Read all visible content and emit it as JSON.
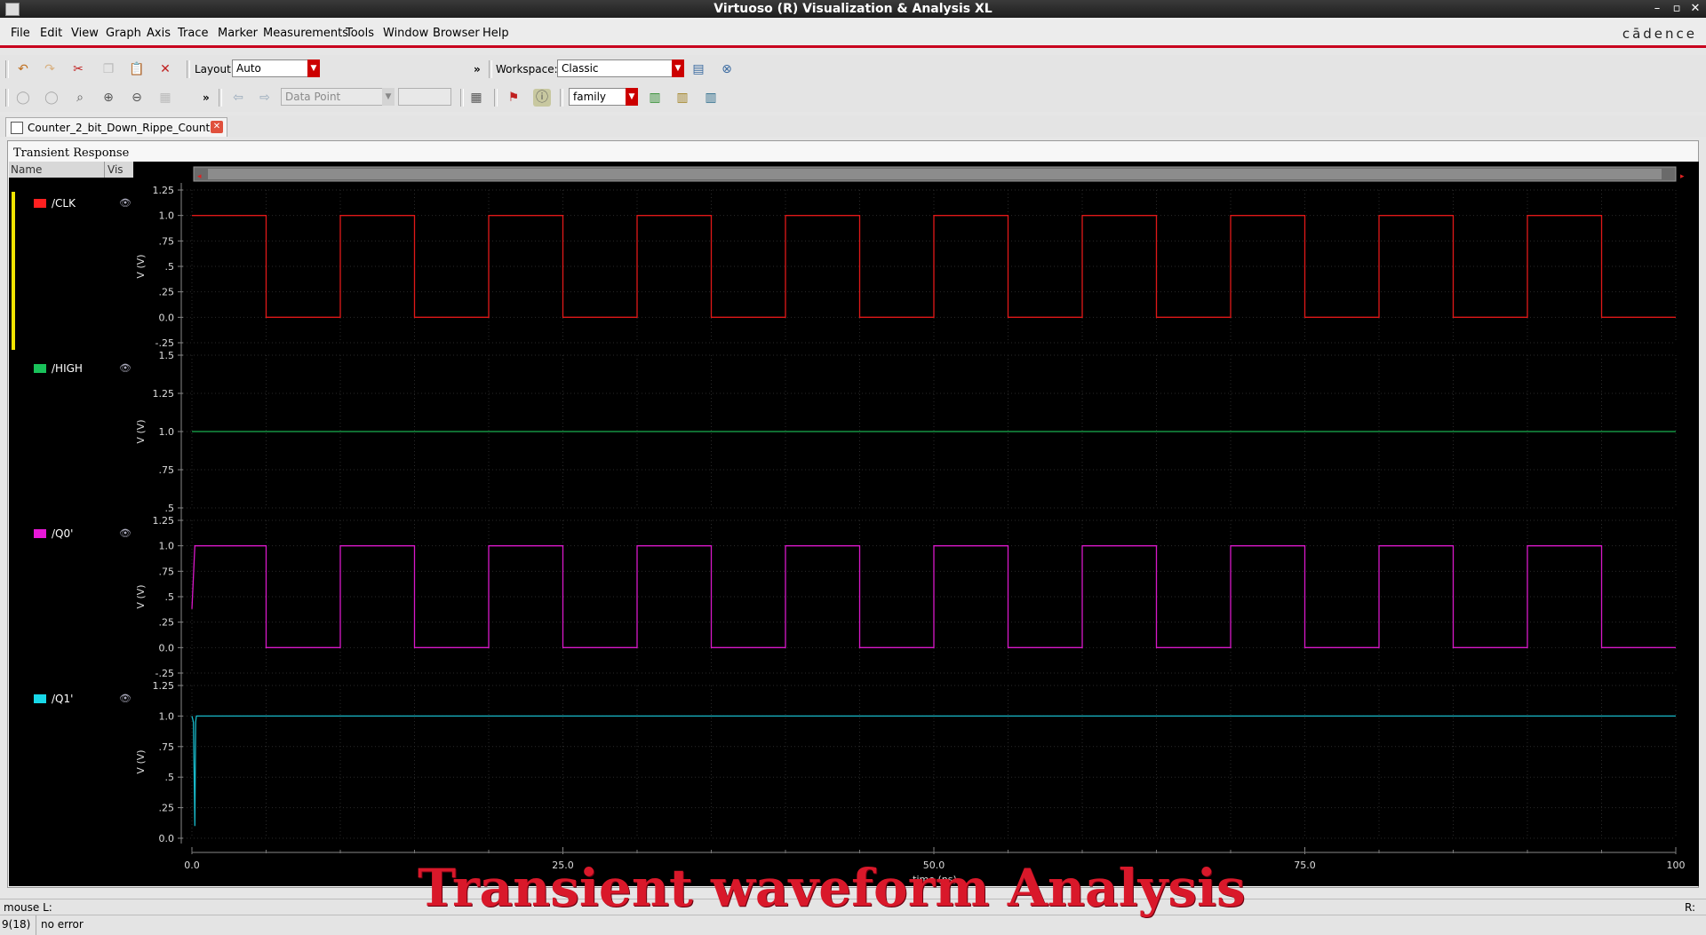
{
  "window": {
    "title": "Virtuoso (R) Visualization & Analysis XL",
    "controls": [
      "–",
      "▫",
      "✕"
    ]
  },
  "menu": [
    "File",
    "Edit",
    "View",
    "Graph",
    "Axis",
    "Trace",
    "Marker",
    "Measurements",
    "Tools",
    "Window",
    "Browser",
    "Help"
  ],
  "brand": "cādence",
  "toolbar1": {
    "layout_label": "Layout:",
    "layout_value": "Auto",
    "overflow": "»",
    "workspace_label": "Workspace:",
    "workspace_value": "Classic"
  },
  "toolbar2": {
    "overflow": "»",
    "data_point": "Data Point",
    "family": "family"
  },
  "tab": {
    "label": "Counter_2_bit_Down_Rippe_Count..."
  },
  "window_title": "Transient Response",
  "legend": {
    "header_name": "Name",
    "header_vis": "Vis",
    "signals": [
      {
        "name": "/CLK",
        "color": "#ff2020"
      },
      {
        "name": "/HIGH",
        "color": "#19c25a"
      },
      {
        "name": "/Q0'",
        "color": "#e818d8"
      },
      {
        "name": "/Q1'",
        "color": "#18d8e8"
      }
    ]
  },
  "chart_data": [
    {
      "type": "line",
      "name": "/CLK",
      "color": "#e01818",
      "ylabel": "V (V)",
      "ylim": [
        -0.25,
        1.25
      ],
      "yticks": [
        "1.25",
        "1.0",
        ".75",
        ".5",
        ".25",
        "0.0",
        "-.25"
      ],
      "yvals": [
        1.25,
        1.0,
        0.75,
        0.5,
        0.25,
        0.0,
        -0.25
      ],
      "x": [
        0,
        5,
        5,
        10,
        10,
        15,
        15,
        20,
        20,
        25,
        25,
        30,
        30,
        35,
        35,
        40,
        40,
        45,
        45,
        50,
        50,
        55,
        55,
        60,
        60,
        65,
        65,
        70,
        70,
        75,
        75,
        80,
        80,
        85,
        85,
        90,
        90,
        95,
        95,
        100
      ],
      "y": [
        1,
        1,
        0,
        0,
        1,
        1,
        0,
        0,
        1,
        1,
        0,
        0,
        1,
        1,
        0,
        0,
        1,
        1,
        0,
        0,
        1,
        1,
        0,
        0,
        1,
        1,
        0,
        0,
        1,
        1,
        0,
        0,
        1,
        1,
        0,
        0,
        1,
        1,
        0,
        0
      ]
    },
    {
      "type": "line",
      "name": "/HIGH",
      "color": "#19b050",
      "ylabel": "V (V)",
      "ylim": [
        0.5,
        1.5
      ],
      "yticks": [
        "1.5",
        "1.25",
        "1.0",
        ".75",
        ".5"
      ],
      "yvals": [
        1.5,
        1.25,
        1.0,
        0.75,
        0.5
      ],
      "x": [
        0,
        100
      ],
      "y": [
        1,
        1
      ]
    },
    {
      "type": "line",
      "name": "/Q0'",
      "color": "#d818c8",
      "ylabel": "V (V)",
      "ylim": [
        -0.25,
        1.25
      ],
      "yticks": [
        "1.25",
        "1.0",
        ".75",
        ".5",
        ".25",
        "0.0",
        "-.25"
      ],
      "yvals": [
        1.25,
        1.0,
        0.75,
        0.5,
        0.25,
        0.0,
        -0.25
      ],
      "x": [
        0,
        0.2,
        0.2,
        5,
        5,
        10,
        10,
        15,
        15,
        20,
        20,
        25,
        25,
        30,
        30,
        35,
        35,
        40,
        40,
        45,
        45,
        50,
        50,
        55,
        55,
        60,
        60,
        65,
        65,
        70,
        70,
        75,
        75,
        80,
        80,
        85,
        85,
        90,
        90,
        95,
        95,
        100
      ],
      "y": [
        0.38,
        1,
        1,
        1,
        0,
        0,
        1,
        1,
        0,
        0,
        1,
        1,
        0,
        0,
        1,
        1,
        0,
        0,
        1,
        1,
        0,
        0,
        1,
        1,
        0,
        0,
        1,
        1,
        0,
        0,
        1,
        1,
        0,
        0,
        1,
        1,
        0,
        0,
        1,
        1,
        0,
        0
      ]
    },
    {
      "type": "line",
      "name": "/Q1'",
      "color": "#18b8c8",
      "ylabel": "V (V)",
      "ylim": [
        0.0,
        1.25
      ],
      "yticks": [
        "1.25",
        "1.0",
        ".75",
        ".5",
        ".25",
        "0.0"
      ],
      "yvals": [
        1.25,
        1.0,
        0.75,
        0.5,
        0.25,
        0.0
      ],
      "x": [
        0,
        0.1,
        0.2,
        0.25,
        0.3,
        100
      ],
      "y": [
        1,
        0.95,
        0.1,
        0.95,
        1,
        1
      ]
    }
  ],
  "x_axis": {
    "label": "time (ns)",
    "xlim": [
      0,
      100
    ],
    "ticks": [
      "0.0",
      "25.0",
      "50.0",
      "75.0",
      "100"
    ],
    "tick_vals": [
      0,
      25,
      50,
      75,
      100
    ]
  },
  "overlay_text": "Transient waveform Analysis",
  "statusbar": {
    "mouse_left": "mouse L:",
    "mouse_right": "R:",
    "index": "9(18)",
    "message": "no error"
  }
}
